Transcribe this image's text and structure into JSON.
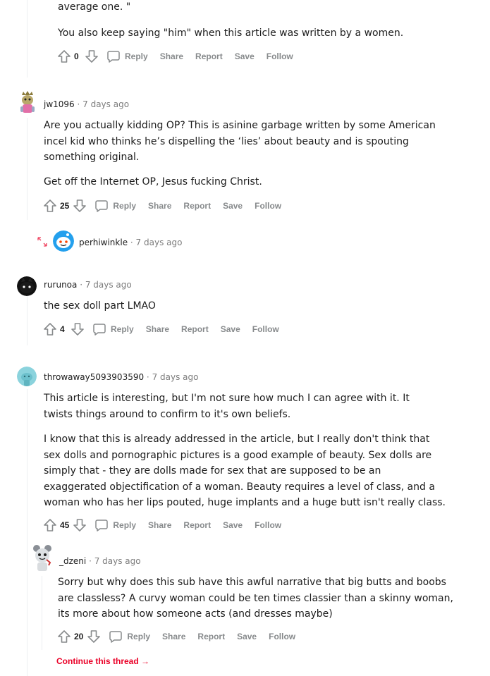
{
  "comments": [
    {
      "paragraphs": [
        "average one. \"",
        "You also keep saying \"him\" when this article was written by a women."
      ],
      "score": "0",
      "actions": {
        "reply": "Reply",
        "share": "Share",
        "report": "Report",
        "save": "Save",
        "follow": "Follow"
      }
    },
    {
      "username": "jw1096",
      "time": "7 days ago",
      "paragraphs": [
        "Are you actually kidding OP? This is asinine garbage written by some American incel kid who thinks he’s dispelling the ‘lies’ about beauty and is spouting something original.",
        "Get off the Internet OP, Jesus fucking Christ."
      ],
      "score": "25",
      "actions": {
        "reply": "Reply",
        "share": "Share",
        "report": "Report",
        "save": "Save",
        "follow": "Follow"
      }
    },
    {
      "username": "perhiwinkle",
      "time": "7 days ago",
      "collapsed": true
    },
    {
      "username": "rurunoa",
      "time": "7 days ago",
      "paragraphs": [
        "the sex doll part LMAO"
      ],
      "score": "4",
      "actions": {
        "reply": "Reply",
        "share": "Share",
        "report": "Report",
        "save": "Save",
        "follow": "Follow"
      }
    },
    {
      "username": "throwaway5093903590",
      "time": "7 days ago",
      "paragraphs": [
        "This article is interesting, but I'm not sure how much I can agree with it. It twists things around to confirm to it's own beliefs.",
        "I know that this is already addressed in the article, but I really don't think that sex dolls and pornographic pictures is a good example of beauty. Sex dolls are simply that - they are dolls made for sex that are supposed to be an exaggerated objectification of a woman. Beauty requires a level of class, and a woman who has her lips pouted, huge implants and a huge butt isn't really class."
      ],
      "score": "45",
      "actions": {
        "reply": "Reply",
        "share": "Share",
        "report": "Report",
        "save": "Save",
        "follow": "Follow"
      }
    },
    {
      "username": "_dzeni",
      "time": "7 days ago",
      "paragraphs": [
        "Sorry but why does this sub have this awful narrative that big butts and boobs are classless? A curvy woman could be ten times classier than a skinny woman, its more about how someone acts (and dresses maybe)"
      ],
      "score": "20",
      "actions": {
        "reply": "Reply",
        "share": "Share",
        "report": "Report",
        "save": "Save",
        "follow": "Follow"
      }
    }
  ],
  "continue_thread": "Continue this thread",
  "colors": {
    "accent_red": "#ea0027",
    "muted": "#878a8c",
    "thread_line": "#edeff1"
  }
}
